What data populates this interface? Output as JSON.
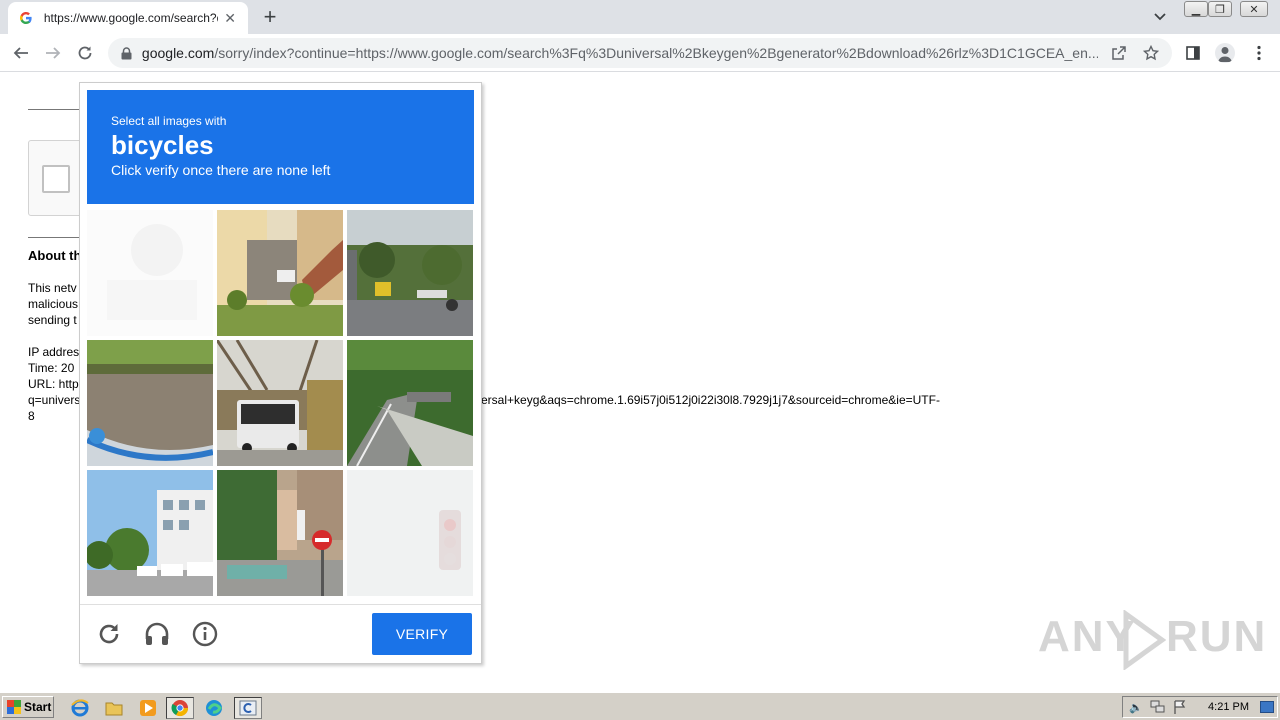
{
  "browser": {
    "tab": {
      "title": "https://www.google.com/search?q=u",
      "favicon": "google-g-icon"
    },
    "address_bar": {
      "host": "google.com",
      "path": "/sorry/index?continue=https://www.google.com/search%3Fq%3Duniversal%2Bkeygen%2Bgenerator%2Bdownload%26rlz%3D1C1GCEA_en..."
    }
  },
  "page": {
    "about_heading": "About th",
    "paragraph_lines": [
      "This netv",
      "malicious",
      "sending t"
    ],
    "info_lines": [
      "IP addres",
      "Time: 20",
      "URL: http"
    ],
    "url_line_left": "q=univers",
    "url_line_right": "ersal+keyg&aqs=chrome.1.69i57j0i512j0i22i30l8.7929j1j7&sourceid=chrome&ie=UTF-",
    "url_line_end": "8"
  },
  "captcha": {
    "instruction_line1": "Select all images with",
    "target_object": "bicycles",
    "instruction_line2": "Click verify once there are none left",
    "verify_label": "VERIFY",
    "tiles": [
      {
        "desc": "faded blank tile"
      },
      {
        "desc": "house exterior with stairs"
      },
      {
        "desc": "street with sign and motorbike"
      },
      {
        "desc": "road edge with grass"
      },
      {
        "desc": "white bus on street"
      },
      {
        "desc": "curving mountain road"
      },
      {
        "desc": "street with buildings and parked cars"
      },
      {
        "desc": "plaza with no-entry sign"
      },
      {
        "desc": "faded traffic light tile"
      }
    ],
    "colors": {
      "header": "#1a73e8",
      "button": "#1a73e8"
    }
  },
  "watermark": {
    "left": "ANY",
    "right": "RUN"
  },
  "taskbar": {
    "start_label": "Start",
    "clock": "4:21 PM",
    "apps": [
      "ie-icon",
      "explorer-icon",
      "media-player-icon",
      "chrome-icon",
      "edge-icon",
      "cmd-icon"
    ]
  }
}
